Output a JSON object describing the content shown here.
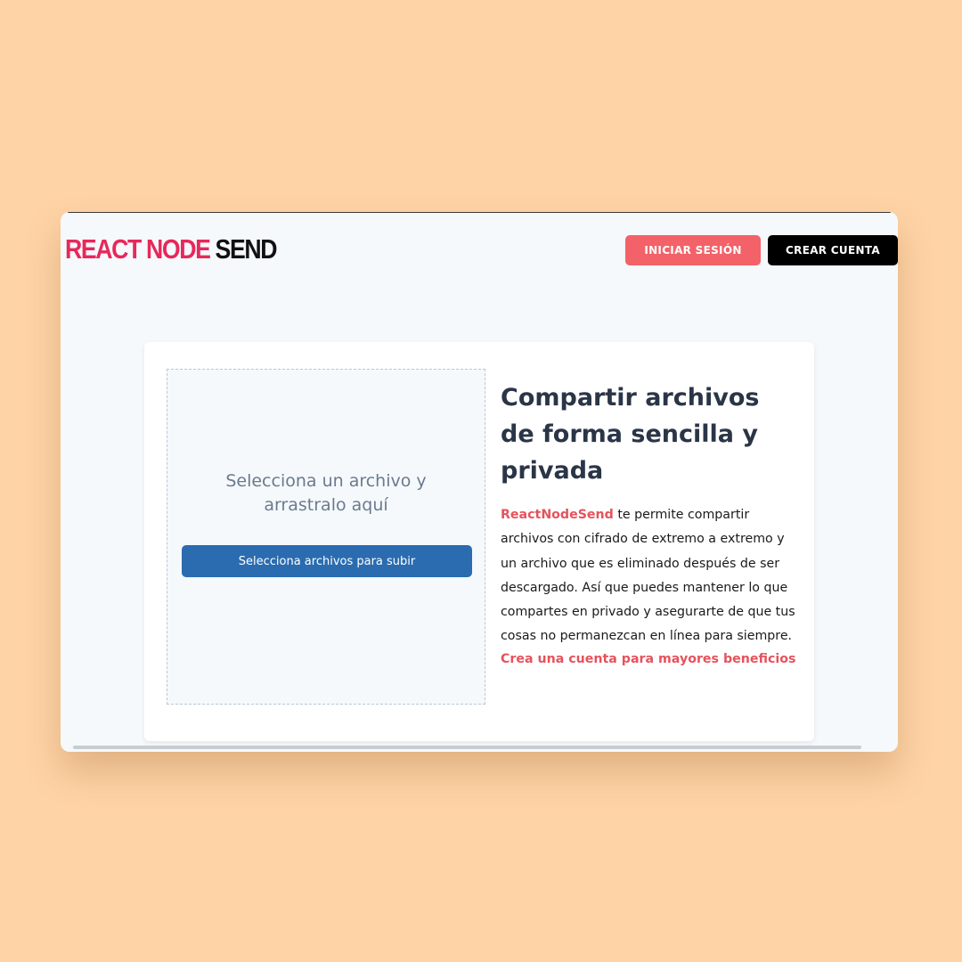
{
  "header": {
    "logo_part_1": "REACT NODE",
    "logo_part_2": "SEND",
    "login_label": "INICIAR SESIÓN",
    "register_label": "CREAR CUENTA"
  },
  "dropzone": {
    "text": "Selecciona un archivo y arrastralo aquí",
    "button_label": "Selecciona archivos para subir"
  },
  "info": {
    "title": "Compartir archivos de forma sencilla y privada",
    "brand": "ReactNodeSend",
    "body": " te permite compartir archivos con cifrado de extremo a extremo y un archivo que es eliminado después de ser descargado. Así que puedes mantener lo que compartes en privado y asegurarte de que tus cosas no permanezcan en línea para siempre.",
    "link_label": "Crea una cuenta para mayores beneficios"
  },
  "colors": {
    "page_background": "#fed3a6",
    "app_background": "#f5f9fc",
    "logo_accent": "#e8285a",
    "login_button": "#f26268",
    "register_button": "#000000",
    "upload_button": "#2b6cb0",
    "link": "#e5535c",
    "title": "#2a3547"
  }
}
